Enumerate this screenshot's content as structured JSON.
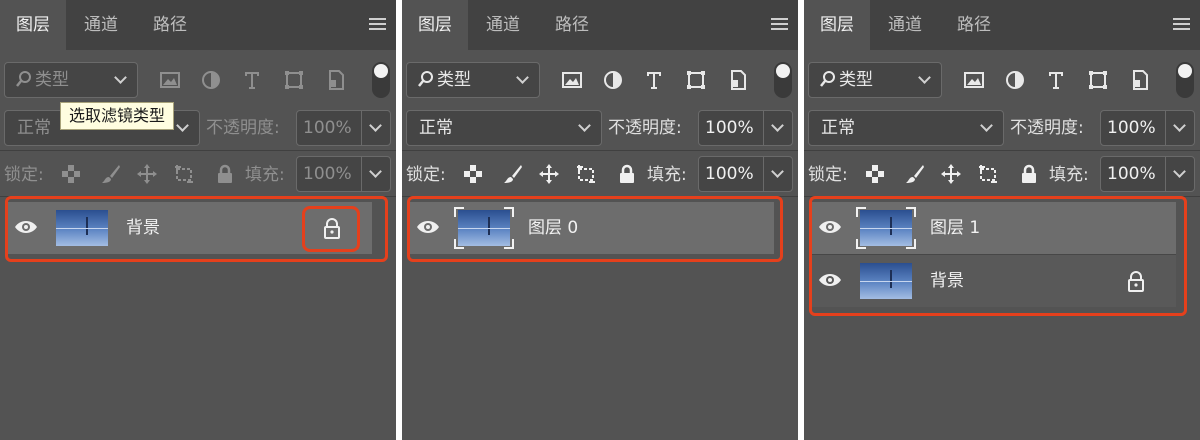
{
  "tabs": [
    "图层",
    "通道",
    "路径"
  ],
  "filter": {
    "label": "类型"
  },
  "filter_icons": [
    "image-filter-icon",
    "adjustment-filter-icon",
    "type-filter-icon",
    "shape-filter-icon",
    "smart-object-filter-icon"
  ],
  "blend_mode": "正常",
  "opacity_label": "不透明度:",
  "opacity_value": "100%",
  "lock_label": "锁定:",
  "lock_icons": [
    "lock-transparent-pixels-icon",
    "lock-image-pixels-icon",
    "lock-position-icon",
    "lock-artboard-icon",
    "lock-all-icon"
  ],
  "fill_label": "填充:",
  "fill_value": "100%",
  "tooltip": "选取滤镜类型",
  "panels": [
    {
      "state": "disabled",
      "layers": [
        {
          "name": "背景",
          "locked": true,
          "selected": false
        }
      ]
    },
    {
      "state": "active",
      "layers": [
        {
          "name": "图层 0",
          "locked": false,
          "selected": true
        }
      ]
    },
    {
      "state": "active",
      "layers": [
        {
          "name": "图层 1",
          "locked": false,
          "selected": true
        },
        {
          "name": "背景",
          "locked": true,
          "selected": false
        }
      ]
    }
  ],
  "colors": {
    "panel_bg": "#535353",
    "tab_bar": "#424242",
    "selected_layer": "#6d6d6d",
    "highlight": "#e5401c",
    "tooltip_bg": "#fffde0"
  }
}
